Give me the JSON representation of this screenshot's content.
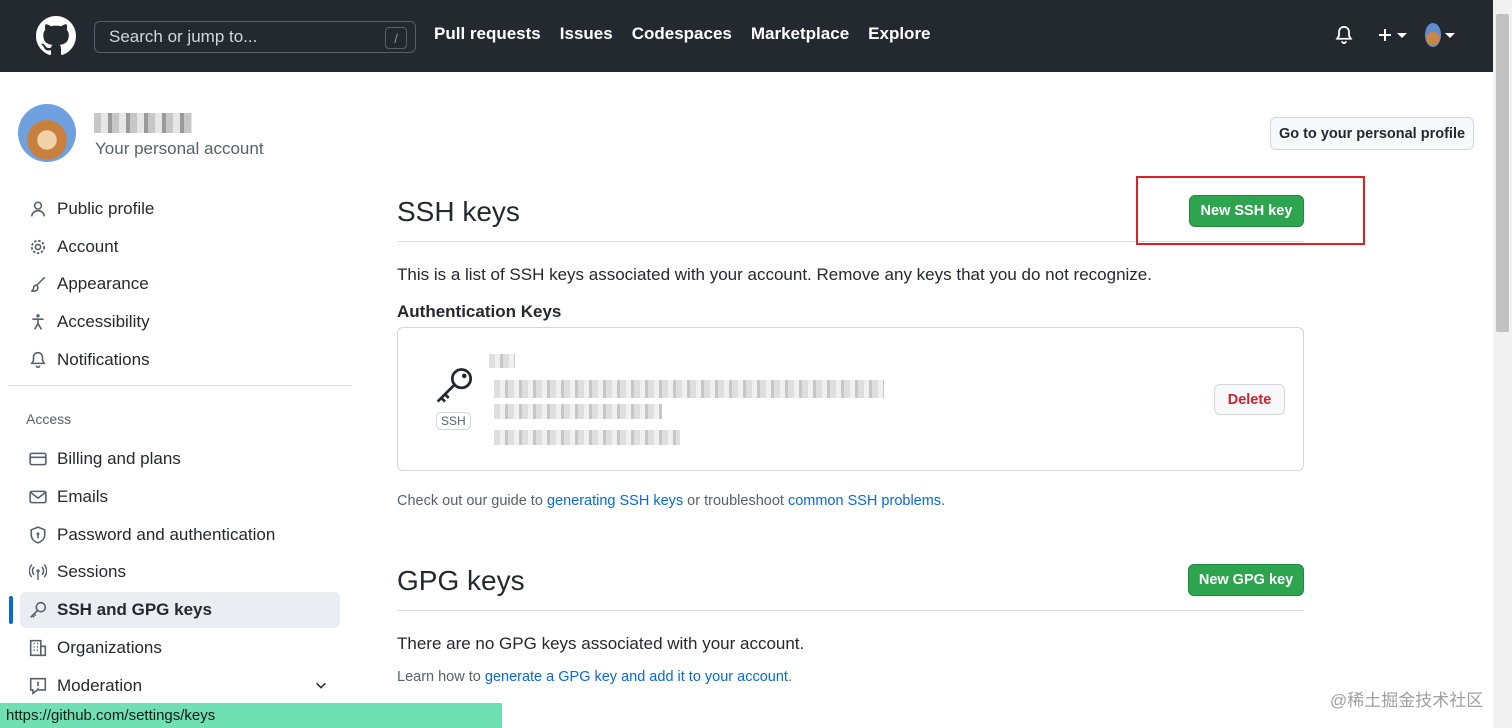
{
  "header": {
    "search_placeholder": "Search or jump to...",
    "search_shortcut": "/",
    "nav": [
      "Pull requests",
      "Issues",
      "Codespaces",
      "Marketplace",
      "Explore"
    ]
  },
  "account": {
    "subtitle": "Your personal account",
    "profile_button": "Go to your personal profile"
  },
  "sidebar": {
    "items": [
      {
        "label": "Public profile",
        "icon": "person-icon"
      },
      {
        "label": "Account",
        "icon": "gear-icon"
      },
      {
        "label": "Appearance",
        "icon": "paintbrush-icon"
      },
      {
        "label": "Accessibility",
        "icon": "accessibility-icon"
      },
      {
        "label": "Notifications",
        "icon": "bell-icon"
      }
    ],
    "access_heading": "Access",
    "access_items": [
      {
        "label": "Billing and plans",
        "icon": "credit-card-icon"
      },
      {
        "label": "Emails",
        "icon": "mail-icon"
      },
      {
        "label": "Password and authentication",
        "icon": "shield-lock-icon"
      },
      {
        "label": "Sessions",
        "icon": "broadcast-icon"
      },
      {
        "label": "SSH and GPG keys",
        "icon": "key-icon",
        "active": true
      },
      {
        "label": "Organizations",
        "icon": "organization-icon"
      },
      {
        "label": "Moderation",
        "icon": "report-icon"
      }
    ]
  },
  "ssh": {
    "title": "SSH keys",
    "new_button": "New SSH key",
    "description": "This is a list of SSH keys associated with your account. Remove any keys that you do not recognize.",
    "auth_title": "Authentication Keys",
    "key_badge": "SSH",
    "delete_button": "Delete",
    "guide_prefix": "Check out our guide to ",
    "guide_link1": "generating SSH keys",
    "guide_middle": " or troubleshoot ",
    "guide_link2": "common SSH problems",
    "guide_suffix": "."
  },
  "gpg": {
    "title": "GPG keys",
    "new_button": "New GPG key",
    "description": "There are no GPG keys associated with your account.",
    "learn_prefix": "Learn how to ",
    "learn_link": "generate a GPG key and add it to your account",
    "learn_suffix": "."
  },
  "statusbar": {
    "url": "https://github.com/settings/keys"
  },
  "watermark": "@稀土掘金技术社区",
  "colors": {
    "header_bg": "#24292f",
    "primary_green": "#2da44e",
    "link_blue": "#0969da",
    "danger_red": "#cf222e",
    "highlight_red": "#e02020"
  }
}
